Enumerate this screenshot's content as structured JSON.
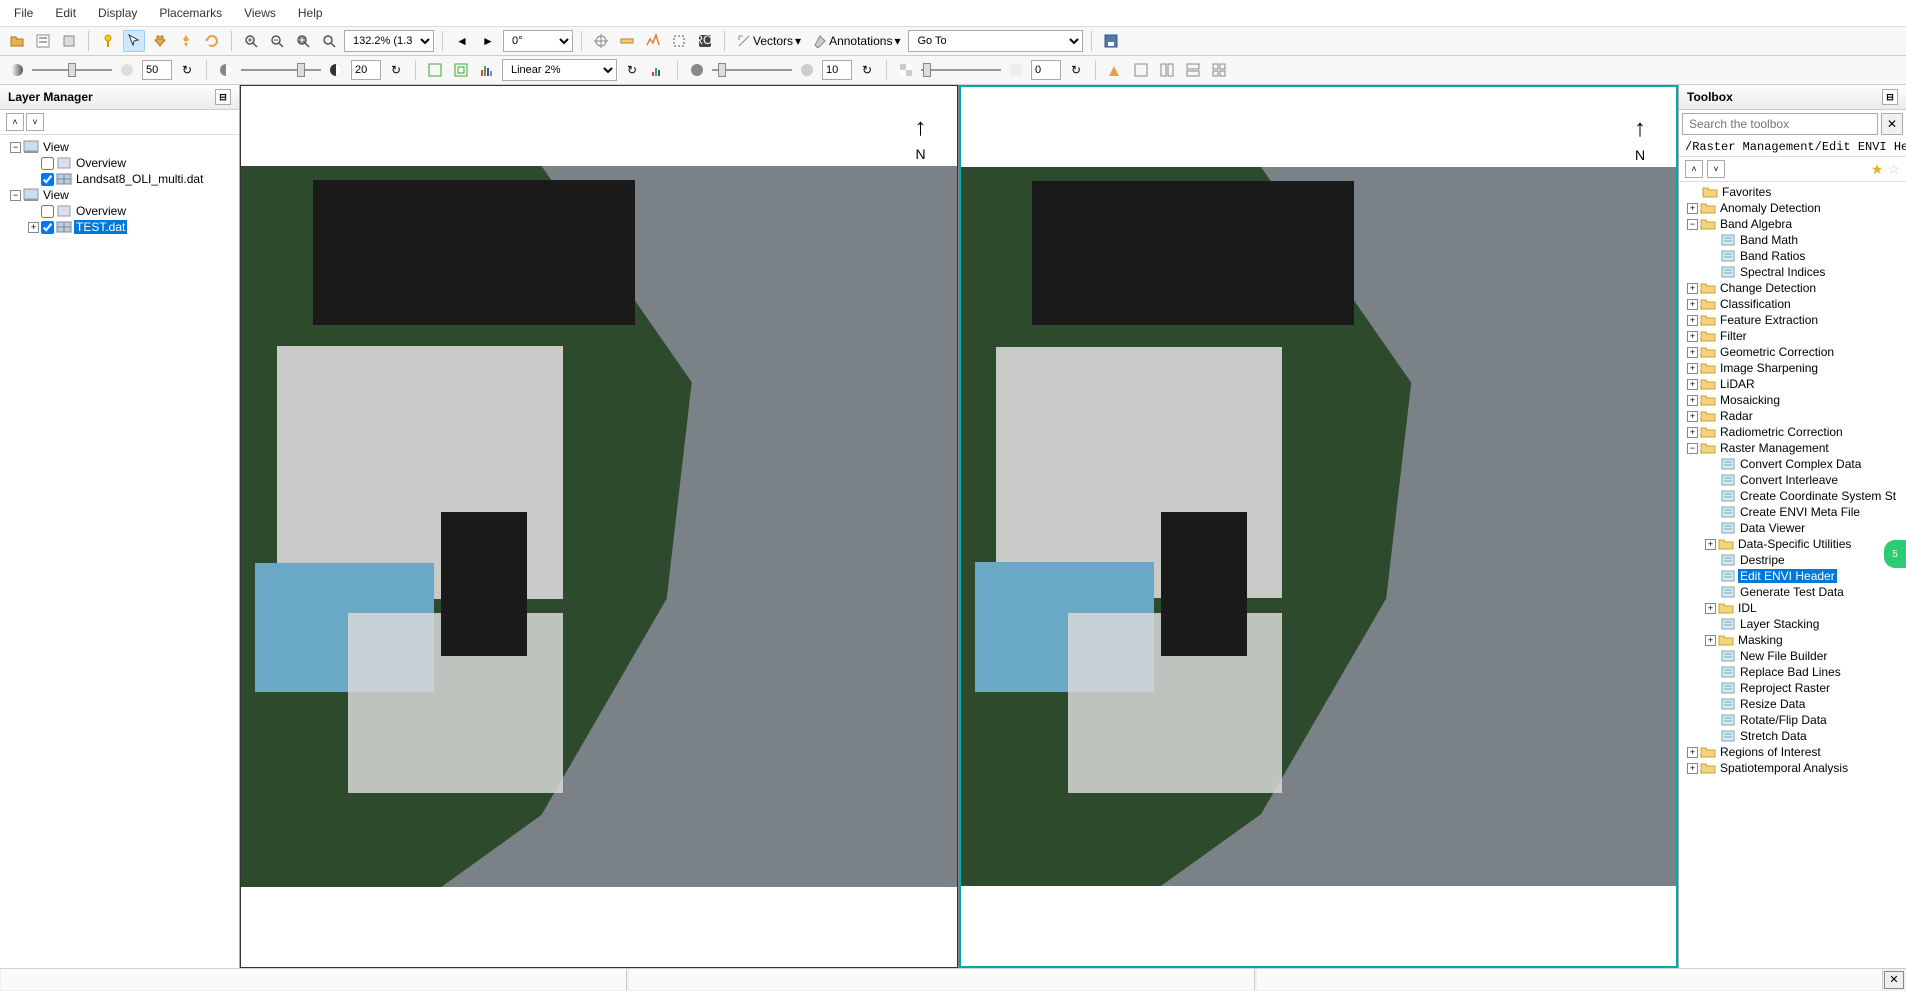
{
  "menubar": [
    "File",
    "Edit",
    "Display",
    "Placemarks",
    "Views",
    "Help"
  ],
  "toolbar1": {
    "zoom_combo": "132.2% (1.3::",
    "rotation": "0°",
    "vectors_label": "Vectors",
    "annotations_label": "Annotations",
    "goto_label": "Go To"
  },
  "toolbar2": {
    "brightness1": "50",
    "brightness2": "20",
    "stretch_combo": "Linear 2%",
    "val3": "10",
    "val4": "0"
  },
  "layer_panel": {
    "title": "Layer Manager",
    "tree": [
      {
        "level": 0,
        "toggle": "-",
        "checkbox": null,
        "icon": "view",
        "label": "View",
        "selected": false
      },
      {
        "level": 1,
        "toggle": null,
        "checkbox": false,
        "icon": "layer",
        "label": "Overview",
        "selected": false
      },
      {
        "level": 1,
        "toggle": null,
        "checkbox": true,
        "icon": "raster",
        "label": "Landsat8_OLI_multi.dat",
        "selected": false
      },
      {
        "level": 0,
        "toggle": "-",
        "checkbox": null,
        "icon": "view",
        "label": "View",
        "selected": false
      },
      {
        "level": 1,
        "toggle": null,
        "checkbox": false,
        "icon": "layer",
        "label": "Overview",
        "selected": false
      },
      {
        "level": 1,
        "toggle": "+",
        "checkbox": true,
        "icon": "raster",
        "label": "TEST.dat",
        "selected": true
      }
    ]
  },
  "toolbox_panel": {
    "title": "Toolbox",
    "search_placeholder": "Search the toolbox",
    "path": "/Raster Management/Edit ENVI Header",
    "tree": [
      {
        "level": 0,
        "toggle": null,
        "type": "folder",
        "label": "Favorites",
        "selected": false
      },
      {
        "level": 0,
        "toggle": "+",
        "type": "folder",
        "label": "Anomaly Detection",
        "selected": false
      },
      {
        "level": 0,
        "toggle": "-",
        "type": "folder",
        "label": "Band Algebra",
        "selected": false
      },
      {
        "level": 1,
        "toggle": null,
        "type": "tool",
        "label": "Band Math",
        "selected": false
      },
      {
        "level": 1,
        "toggle": null,
        "type": "tool",
        "label": "Band Ratios",
        "selected": false
      },
      {
        "level": 1,
        "toggle": null,
        "type": "tool",
        "label": "Spectral Indices",
        "selected": false
      },
      {
        "level": 0,
        "toggle": "+",
        "type": "folder",
        "label": "Change Detection",
        "selected": false
      },
      {
        "level": 0,
        "toggle": "+",
        "type": "folder",
        "label": "Classification",
        "selected": false
      },
      {
        "level": 0,
        "toggle": "+",
        "type": "folder",
        "label": "Feature Extraction",
        "selected": false
      },
      {
        "level": 0,
        "toggle": "+",
        "type": "folder",
        "label": "Filter",
        "selected": false
      },
      {
        "level": 0,
        "toggle": "+",
        "type": "folder",
        "label": "Geometric Correction",
        "selected": false
      },
      {
        "level": 0,
        "toggle": "+",
        "type": "folder",
        "label": "Image Sharpening",
        "selected": false
      },
      {
        "level": 0,
        "toggle": "+",
        "type": "folder",
        "label": "LiDAR",
        "selected": false
      },
      {
        "level": 0,
        "toggle": "+",
        "type": "folder",
        "label": "Mosaicking",
        "selected": false
      },
      {
        "level": 0,
        "toggle": "+",
        "type": "folder",
        "label": "Radar",
        "selected": false
      },
      {
        "level": 0,
        "toggle": "+",
        "type": "folder",
        "label": "Radiometric Correction",
        "selected": false
      },
      {
        "level": 0,
        "toggle": "-",
        "type": "folder",
        "label": "Raster Management",
        "selected": false
      },
      {
        "level": 1,
        "toggle": null,
        "type": "tool",
        "label": "Convert Complex Data",
        "selected": false
      },
      {
        "level": 1,
        "toggle": null,
        "type": "tool",
        "label": "Convert Interleave",
        "selected": false
      },
      {
        "level": 1,
        "toggle": null,
        "type": "tool",
        "label": "Create Coordinate System St",
        "selected": false
      },
      {
        "level": 1,
        "toggle": null,
        "type": "tool",
        "label": "Create ENVI Meta File",
        "selected": false
      },
      {
        "level": 1,
        "toggle": null,
        "type": "tool",
        "label": "Data Viewer",
        "selected": false
      },
      {
        "level": 1,
        "toggle": "+",
        "type": "folder",
        "label": "Data-Specific Utilities",
        "selected": false
      },
      {
        "level": 1,
        "toggle": null,
        "type": "tool",
        "label": "Destripe",
        "selected": false
      },
      {
        "level": 1,
        "toggle": null,
        "type": "tool",
        "label": "Edit ENVI Header",
        "selected": true
      },
      {
        "level": 1,
        "toggle": null,
        "type": "tool",
        "label": "Generate Test Data",
        "selected": false
      },
      {
        "level": 1,
        "toggle": "+",
        "type": "folder",
        "label": "IDL",
        "selected": false
      },
      {
        "level": 1,
        "toggle": null,
        "type": "tool",
        "label": "Layer Stacking",
        "selected": false
      },
      {
        "level": 1,
        "toggle": "+",
        "type": "folder",
        "label": "Masking",
        "selected": false
      },
      {
        "level": 1,
        "toggle": null,
        "type": "tool",
        "label": "New File Builder",
        "selected": false
      },
      {
        "level": 1,
        "toggle": null,
        "type": "tool",
        "label": "Replace Bad Lines",
        "selected": false
      },
      {
        "level": 1,
        "toggle": null,
        "type": "tool",
        "label": "Reproject Raster",
        "selected": false
      },
      {
        "level": 1,
        "toggle": null,
        "type": "tool",
        "label": "Resize Data",
        "selected": false
      },
      {
        "level": 1,
        "toggle": null,
        "type": "tool",
        "label": "Rotate/Flip Data",
        "selected": false
      },
      {
        "level": 1,
        "toggle": null,
        "type": "tool",
        "label": "Stretch Data",
        "selected": false
      },
      {
        "level": 0,
        "toggle": "+",
        "type": "folder",
        "label": "Regions of Interest",
        "selected": false
      },
      {
        "level": 0,
        "toggle": "+",
        "type": "folder",
        "label": "Spatiotemporal Analysis",
        "selected": false
      }
    ]
  },
  "badge": "5"
}
